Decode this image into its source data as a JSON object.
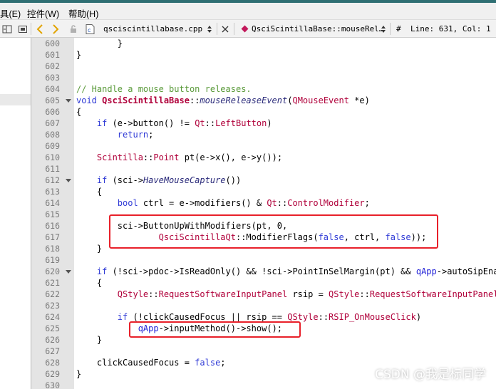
{
  "menubar": {
    "items": [
      "具(E)",
      "控件(W)",
      "帮助(H)"
    ]
  },
  "toolbar": {
    "file_name": "qsciscintillabase.cpp",
    "symbol_name": "QsciScintillaBase::mouseRel…",
    "hash": "#",
    "position": "Line: 631, Col: 1"
  },
  "editor": {
    "lines": [
      {
        "n": "600",
        "fold": false,
        "t": [
          [
            "op",
            "        }"
          ]
        ]
      },
      {
        "n": "601",
        "fold": false,
        "t": [
          [
            "op",
            "}"
          ]
        ]
      },
      {
        "n": "602",
        "fold": false,
        "t": []
      },
      {
        "n": "603",
        "fold": false,
        "t": []
      },
      {
        "n": "604",
        "fold": false,
        "t": [
          [
            "cm",
            "// Handle a mouse button releases."
          ]
        ]
      },
      {
        "n": "605",
        "fold": true,
        "t": [
          [
            "kw",
            "void "
          ],
          [
            "fnb",
            "QsciScintillaBase"
          ],
          [
            "op",
            "::"
          ],
          [
            "fni",
            "mouseReleaseEvent"
          ],
          [
            "op",
            "("
          ],
          [
            "ty",
            "QMouseEvent"
          ],
          [
            "op",
            " *e)"
          ]
        ]
      },
      {
        "n": "606",
        "fold": false,
        "t": [
          [
            "op",
            "{"
          ]
        ]
      },
      {
        "n": "607",
        "fold": false,
        "t": [
          [
            "kw",
            "    if "
          ],
          [
            "op",
            "(e->"
          ],
          [
            "fnl",
            "button"
          ],
          [
            "op",
            "() != "
          ],
          [
            "ty",
            "Qt"
          ],
          [
            "op",
            "::"
          ],
          [
            "ty2",
            "LeftButton"
          ],
          [
            "op",
            ")"
          ]
        ]
      },
      {
        "n": "608",
        "fold": false,
        "t": [
          [
            "kw",
            "        return"
          ],
          [
            "op",
            ";"
          ]
        ]
      },
      {
        "n": "609",
        "fold": false,
        "t": []
      },
      {
        "n": "610",
        "fold": false,
        "t": [
          [
            "ty",
            "    Scintilla"
          ],
          [
            "op",
            "::"
          ],
          [
            "ty",
            "Point "
          ],
          [
            "op",
            "pt(e->"
          ],
          [
            "fnl",
            "x"
          ],
          [
            "op",
            "(), e->"
          ],
          [
            "fnl",
            "y"
          ],
          [
            "op",
            "());"
          ]
        ]
      },
      {
        "n": "611",
        "fold": false,
        "t": []
      },
      {
        "n": "612",
        "fold": true,
        "t": [
          [
            "kw",
            "    if "
          ],
          [
            "op",
            "(sci->"
          ],
          [
            "fni",
            "HaveMouseCapture"
          ],
          [
            "op",
            "())"
          ]
        ]
      },
      {
        "n": "613",
        "fold": false,
        "t": [
          [
            "op",
            "    {"
          ]
        ]
      },
      {
        "n": "614",
        "fold": false,
        "t": [
          [
            "kw",
            "        bool "
          ],
          [
            "op",
            "ctrl = e->"
          ],
          [
            "fnl",
            "modifiers"
          ],
          [
            "op",
            "() & "
          ],
          [
            "ty",
            "Qt"
          ],
          [
            "op",
            "::"
          ],
          [
            "ty2",
            "ControlModifier"
          ],
          [
            "op",
            ";"
          ]
        ]
      },
      {
        "n": "615",
        "fold": false,
        "t": []
      },
      {
        "n": "616",
        "fold": false,
        "t": [
          [
            "op",
            "        sci->"
          ],
          [
            "fnl",
            "ButtonUpWithModifiers"
          ],
          [
            "op",
            "(pt, 0,"
          ]
        ]
      },
      {
        "n": "617",
        "fold": false,
        "t": [
          [
            "op",
            "                "
          ],
          [
            "ty",
            "QsciScintillaQt"
          ],
          [
            "op",
            "::"
          ],
          [
            "fnl",
            "ModifierFlags"
          ],
          [
            "op",
            "("
          ],
          [
            "kw",
            "false"
          ],
          [
            "op",
            ", ctrl, "
          ],
          [
            "kw",
            "false"
          ],
          [
            "op",
            "));"
          ]
        ]
      },
      {
        "n": "618",
        "fold": false,
        "t": [
          [
            "op",
            "    }"
          ]
        ]
      },
      {
        "n": "619",
        "fold": false,
        "t": []
      },
      {
        "n": "620",
        "fold": true,
        "t": [
          [
            "kw",
            "    if "
          ],
          [
            "op",
            "(!sci->pdoc->"
          ],
          [
            "fnl",
            "IsReadOnly"
          ],
          [
            "op",
            "() && !sci->"
          ],
          [
            "fnl",
            "PointInSelMargin"
          ],
          [
            "op",
            "(pt) && "
          ],
          [
            "bl",
            "qApp"
          ],
          [
            "op",
            "->autoSipEnab"
          ]
        ]
      },
      {
        "n": "621",
        "fold": false,
        "t": [
          [
            "op",
            "    {"
          ]
        ]
      },
      {
        "n": "622",
        "fold": false,
        "t": [
          [
            "ty",
            "        QStyle"
          ],
          [
            "op",
            "::"
          ],
          [
            "ty2",
            "RequestSoftwareInputPanel "
          ],
          [
            "op",
            "rsip = "
          ],
          [
            "ty",
            "QStyle"
          ],
          [
            "op",
            "::"
          ],
          [
            "ty2",
            "RequestSoftwareInputPanel("
          ]
        ]
      },
      {
        "n": "623",
        "fold": false,
        "t": []
      },
      {
        "n": "624",
        "fold": false,
        "t": [
          [
            "kw",
            "        if "
          ],
          [
            "op",
            "(!clickCausedFocus || rsip == "
          ],
          [
            "ty",
            "QStyle"
          ],
          [
            "op",
            "::"
          ],
          [
            "ty2",
            "RSIP_OnMouseClick"
          ],
          [
            "op",
            ")"
          ]
        ]
      },
      {
        "n": "625",
        "fold": false,
        "t": [
          [
            "bl",
            "            qApp"
          ],
          [
            "op",
            "->"
          ],
          [
            "fnl",
            "inputMethod"
          ],
          [
            "op",
            "()->"
          ],
          [
            "fnl",
            "show"
          ],
          [
            "op",
            "();"
          ]
        ]
      },
      {
        "n": "626",
        "fold": false,
        "t": [
          [
            "op",
            "    }"
          ]
        ]
      },
      {
        "n": "627",
        "fold": false,
        "t": []
      },
      {
        "n": "628",
        "fold": false,
        "t": [
          [
            "op",
            "    clickCausedFocus = "
          ],
          [
            "kw",
            "false"
          ],
          [
            "op",
            ";"
          ]
        ]
      },
      {
        "n": "629",
        "fold": false,
        "t": [
          [
            "op",
            "}"
          ]
        ]
      },
      {
        "n": "630",
        "fold": false,
        "t": []
      }
    ]
  },
  "watermark": "CSDN @我是标同学",
  "colors": {
    "comment": "#5a9a3a",
    "keyword": "#2f3ad6",
    "type": "#b0003a",
    "highlight_box": "#e8202a"
  }
}
